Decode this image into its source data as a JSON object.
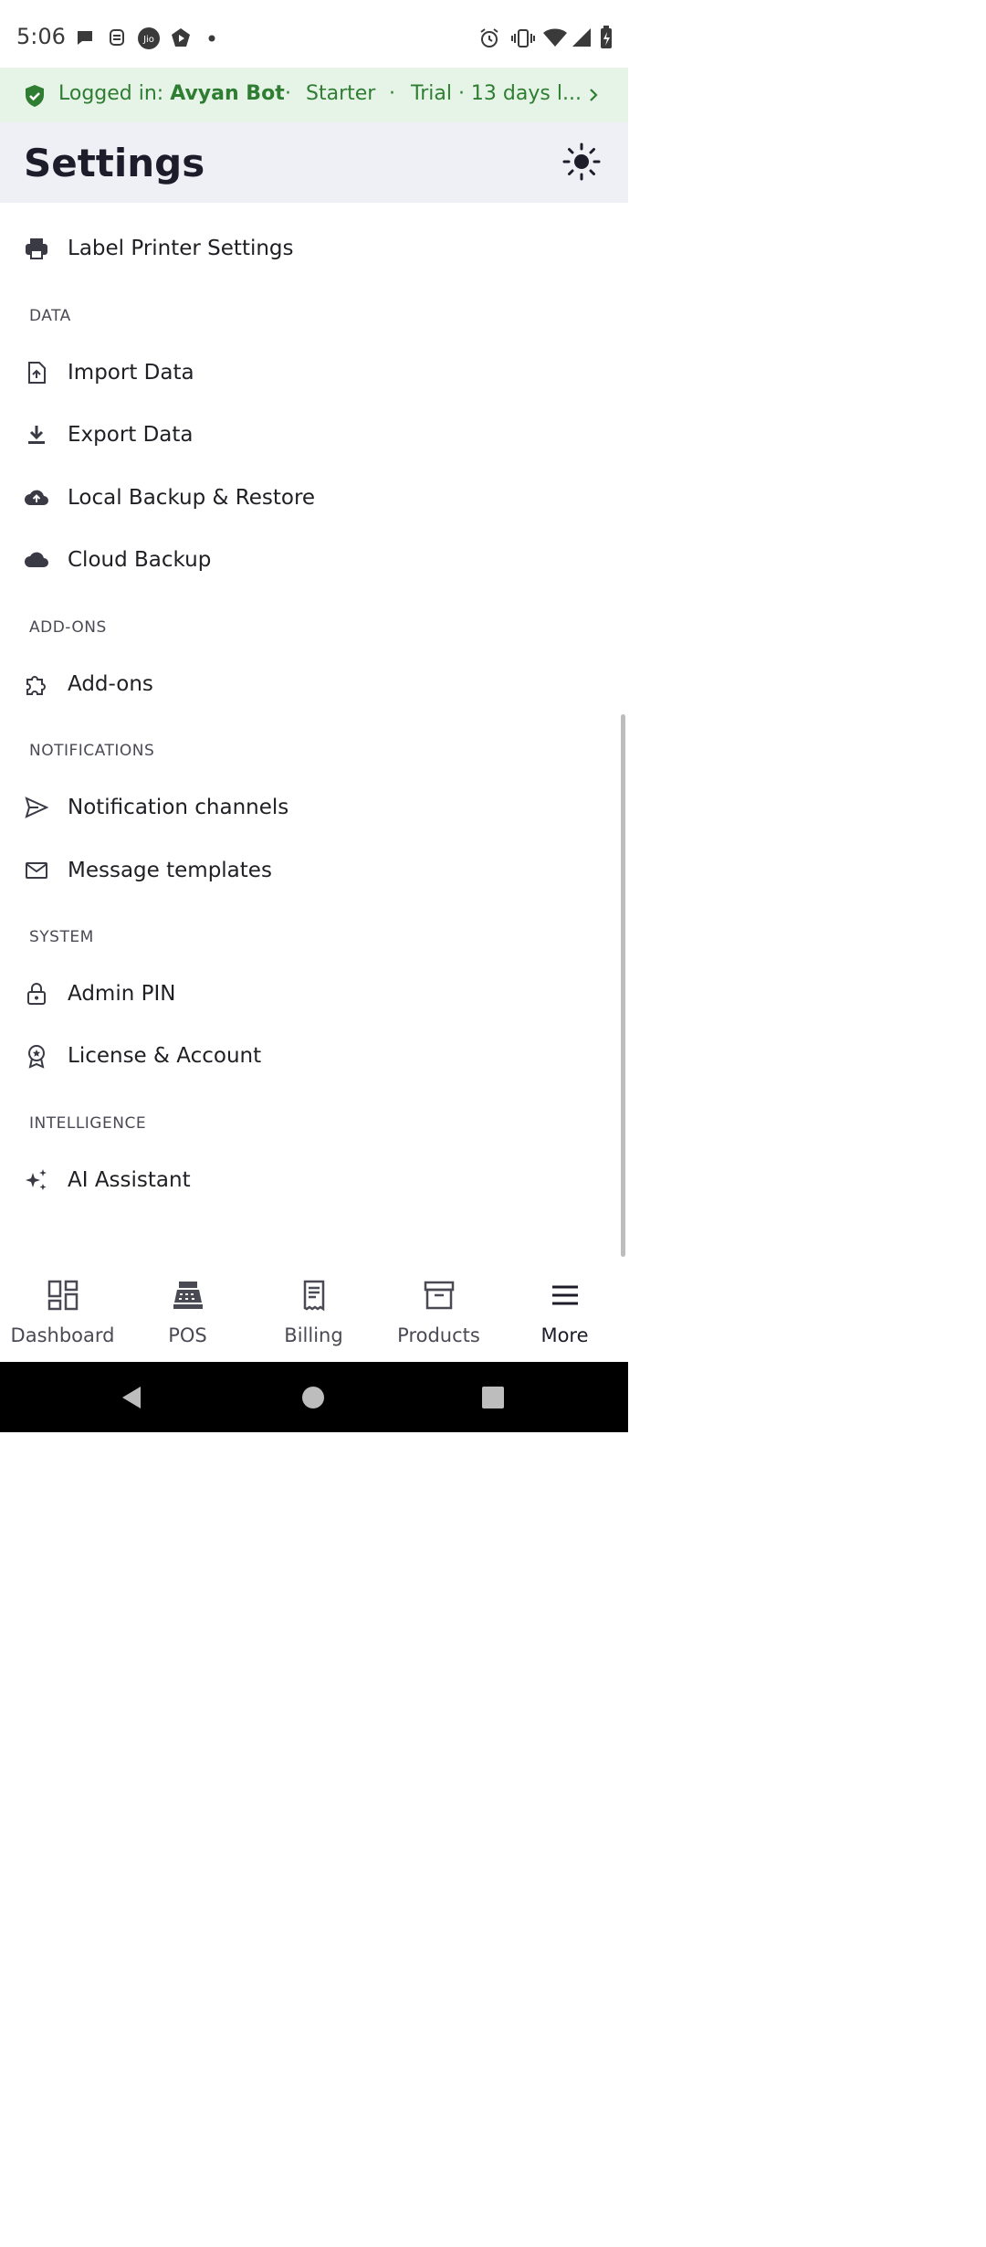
{
  "status_bar": {
    "time": "5:06"
  },
  "banner": {
    "logged_in_label": "Logged in: ",
    "user_name": "Avyan Bot",
    "separator": "·",
    "plan": "Starter",
    "trial": "Trial · 13 days l..."
  },
  "header": {
    "title": "Settings"
  },
  "items": {
    "label_printer": "Label Printer Settings",
    "data_section": "DATA",
    "import_data": "Import Data",
    "export_data": "Export Data",
    "local_backup": "Local Backup & Restore",
    "cloud_backup": "Cloud Backup",
    "addons_section": "ADD-ONS",
    "addons": "Add-ons",
    "notifications_section": "NOTIFICATIONS",
    "notification_channels": "Notification channels",
    "message_templates": "Message templates",
    "system_section": "SYSTEM",
    "admin_pin": "Admin PIN",
    "license_account": "License & Account",
    "intelligence_section": "INTELLIGENCE",
    "ai_assistant": "AI Assistant"
  },
  "bottom_nav": {
    "dashboard": "Dashboard",
    "pos": "POS",
    "billing": "Billing",
    "products": "Products",
    "more": "More",
    "active": "More"
  },
  "colors": {
    "accent_green": "#2e7d32",
    "banner_bg": "#e6f4e7",
    "header_bg": "#eef0f5",
    "active_pill": "#dde4f5"
  }
}
